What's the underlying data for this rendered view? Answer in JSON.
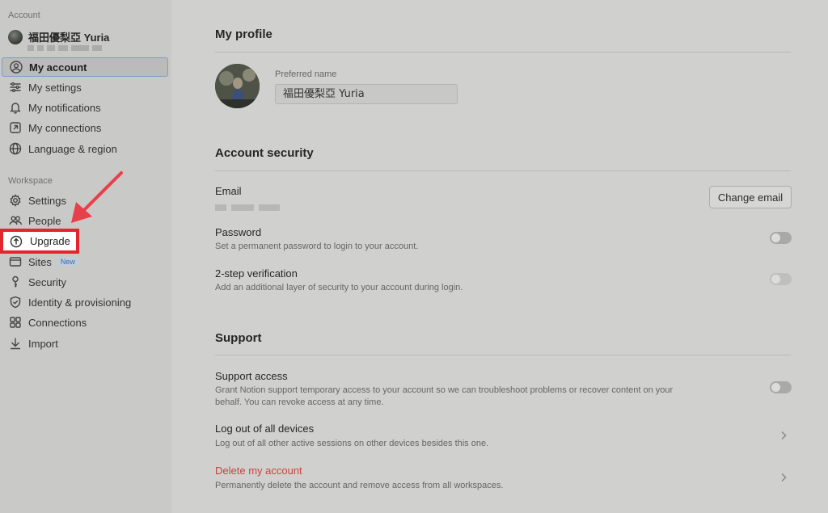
{
  "sidebar": {
    "account_label": "Account",
    "user": {
      "name": "福田優梨亞 Yuria"
    },
    "account_items": [
      {
        "label": "My account",
        "icon": "user-circle-icon"
      },
      {
        "label": "My settings",
        "icon": "sliders-icon"
      },
      {
        "label": "My notifications",
        "icon": "bell-icon"
      },
      {
        "label": "My connections",
        "icon": "link-out-icon"
      },
      {
        "label": "Language & region",
        "icon": "globe-icon"
      }
    ],
    "workspace_label": "Workspace",
    "workspace_items": [
      {
        "label": "Settings",
        "icon": "gear-icon"
      },
      {
        "label": "People",
        "icon": "people-icon"
      },
      {
        "label": "Upgrade",
        "icon": "upgrade-icon"
      },
      {
        "label": "Sites",
        "icon": "sites-icon",
        "badge": "New"
      },
      {
        "label": "Security",
        "icon": "key-icon"
      },
      {
        "label": "Identity & provisioning",
        "icon": "shield-icon"
      },
      {
        "label": "Connections",
        "icon": "grid-icon"
      },
      {
        "label": "Import",
        "icon": "download-icon"
      }
    ]
  },
  "profile": {
    "heading": "My profile",
    "preferred_name_label": "Preferred name",
    "preferred_name_value": "福田優梨亞 Yuria"
  },
  "security": {
    "heading": "Account security",
    "email_label": "Email",
    "change_email_button": "Change email",
    "password_title": "Password",
    "password_desc": "Set a permanent password to login to your account.",
    "two_step_title": "2-step verification",
    "two_step_desc": "Add an additional layer of security to your account during login."
  },
  "support": {
    "heading": "Support",
    "access_title": "Support access",
    "access_desc_line1": "Grant Notion support temporary access to your account so we can troubleshoot problems or recover content on your",
    "access_desc_line2": "behalf. You can revoke access at any time.",
    "logout_title": "Log out of all devices",
    "logout_desc": "Log out of all other active sessions on other devices besides this one.",
    "delete_title": "Delete my account",
    "delete_desc": "Permanently delete the account and remove access from all workspaces."
  },
  "colors": {
    "highlight_border": "#e2262f",
    "arrow": "#e8404a",
    "danger_text": "#c8433e",
    "active_border": "#7d9cc8",
    "badge_new": "#2f6fb6"
  }
}
